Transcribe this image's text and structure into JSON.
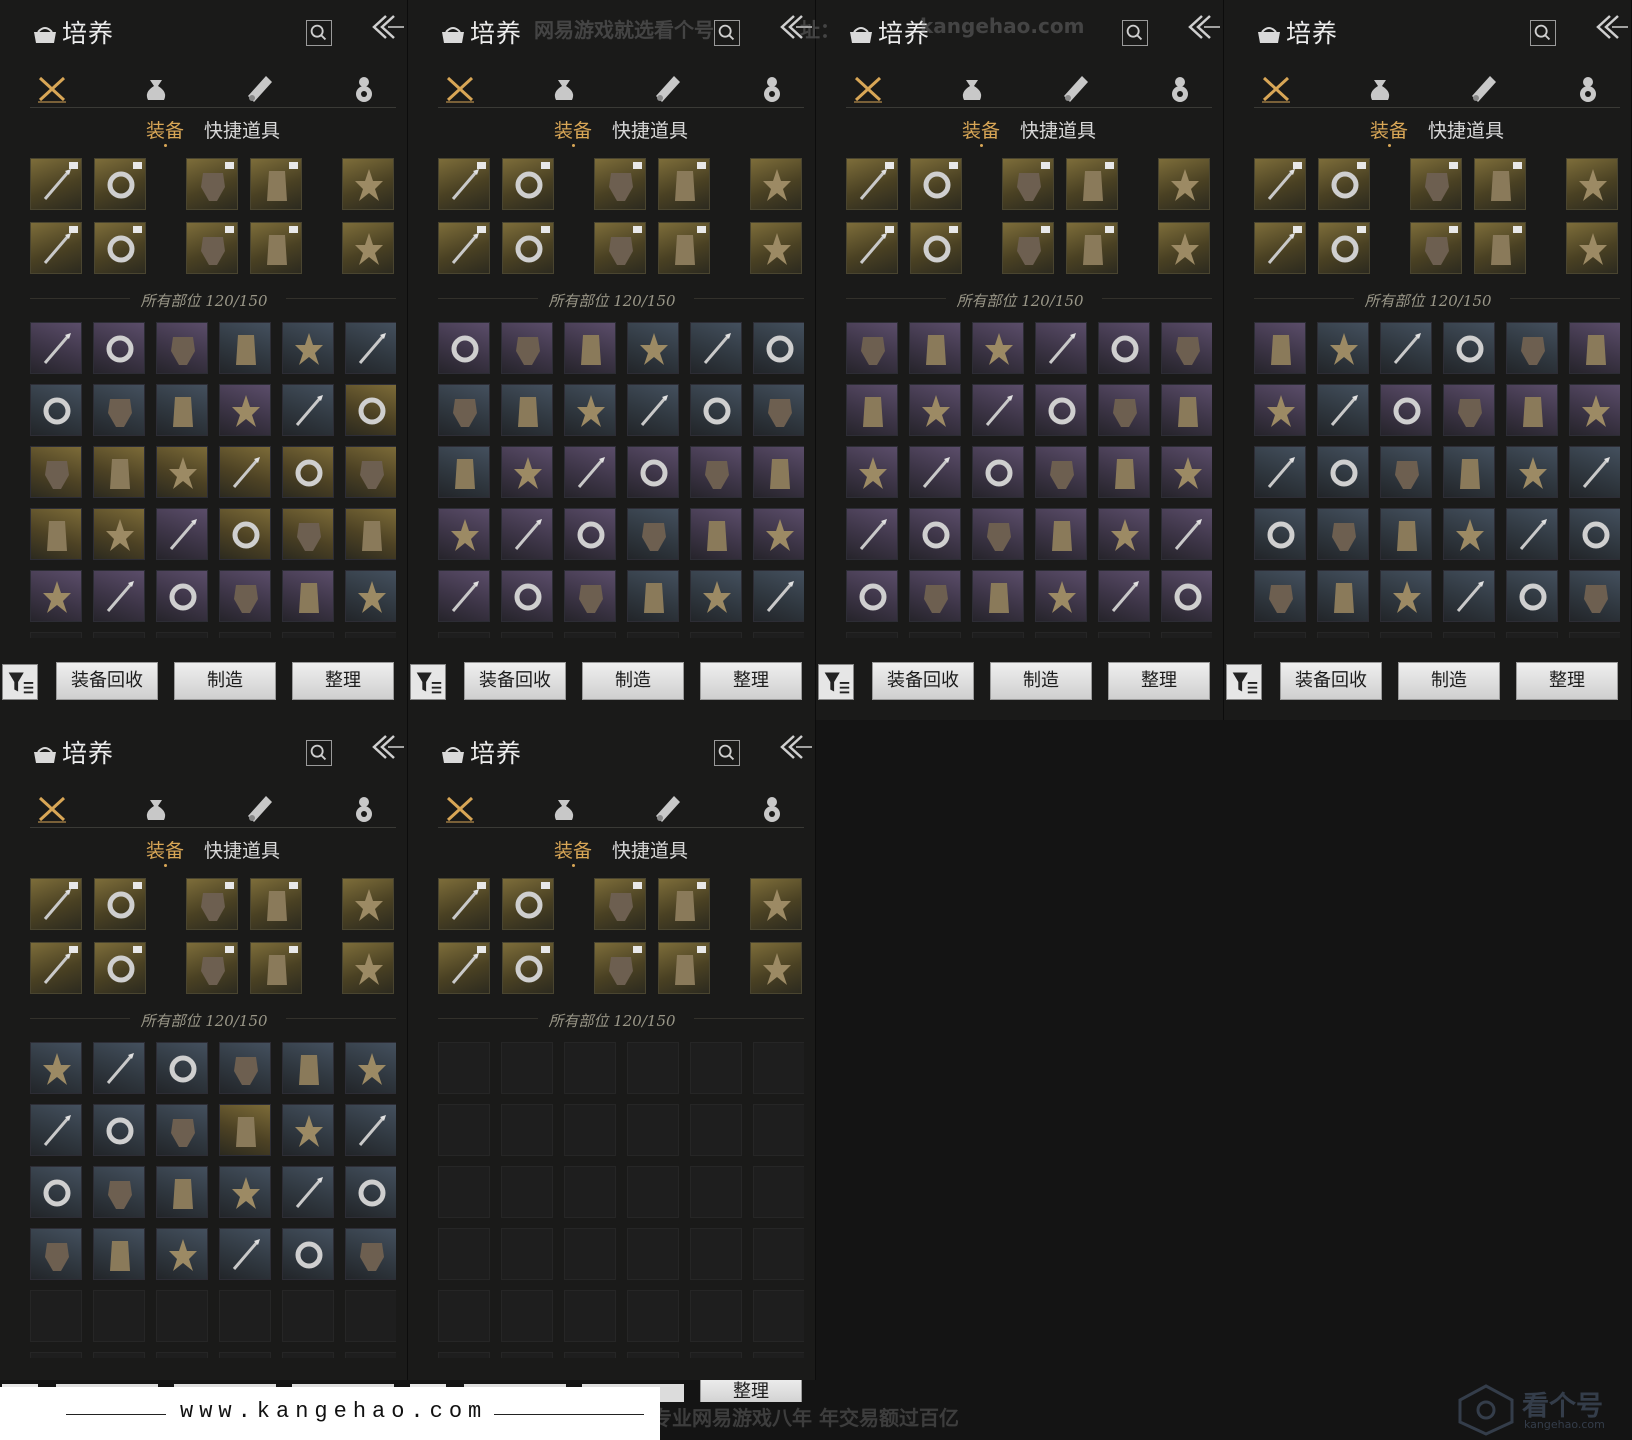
{
  "panel_title": "培养",
  "tabs": {
    "equip": "装备",
    "quick": "快捷道具"
  },
  "capacity_label": "所有部位 120/150",
  "buttons": {
    "recycle": "装备回收",
    "craft": "制造",
    "sort": "整理"
  },
  "category_icons": [
    "crossed-swords-icon",
    "pouch-icon",
    "scroll-icon",
    "gourd-icon"
  ],
  "watermarks": {
    "top": "网易游戏就选看个号",
    "top_url_label": "址：",
    "top_url": "kangehao.com",
    "bottom_slogan": "看个号专业网易游戏八年   年交易额过百亿",
    "footer_url": "www.kangehao.com",
    "brand_name": "看个号",
    "brand_sub": "kangehao.com"
  },
  "colors": {
    "accent_gold": "#d8a656",
    "rarity_gold": "#6b5d30",
    "rarity_purple": "#4e4360",
    "rarity_blue": "#3a4553"
  },
  "inventories": [
    {
      "rarities": [
        "p",
        "p",
        "p",
        "b",
        "b",
        "b",
        "b",
        "b",
        "b",
        "p",
        "b",
        "g",
        "g",
        "g",
        "g",
        "g",
        "g",
        "g",
        "g",
        "g",
        "p",
        "g",
        "g",
        "g",
        "p",
        "p",
        "p",
        "p",
        "p",
        "b"
      ]
    },
    {
      "rarities": [
        "p",
        "p",
        "p",
        "b",
        "b",
        "b",
        "b",
        "b",
        "b",
        "b",
        "b",
        "b",
        "b",
        "p",
        "p",
        "p",
        "p",
        "p",
        "p",
        "p",
        "p",
        "b",
        "p",
        "p",
        "p",
        "p",
        "p",
        "b",
        "b",
        "b"
      ]
    },
    {
      "rarities": [
        "p",
        "p",
        "p",
        "p",
        "p",
        "p",
        "p",
        "p",
        "p",
        "p",
        "p",
        "p",
        "p",
        "p",
        "p",
        "p",
        "p",
        "p",
        "p",
        "p",
        "p",
        "p",
        "p",
        "p",
        "p",
        "p",
        "p",
        "p",
        "p",
        "p"
      ]
    },
    {
      "rarities": [
        "p",
        "b",
        "b",
        "b",
        "b",
        "p",
        "p",
        "b",
        "p",
        "p",
        "p",
        "p",
        "b",
        "b",
        "b",
        "b",
        "b",
        "b",
        "b",
        "b",
        "b",
        "b",
        "b",
        "b",
        "b",
        "b",
        "b",
        "b",
        "b",
        "b"
      ]
    },
    {
      "rarities": [
        "b",
        "b",
        "b",
        "b",
        "b",
        "b",
        "b",
        "b",
        "b",
        "g",
        "b",
        "b",
        "b",
        "b",
        "b",
        "b",
        "b",
        "b",
        "b",
        "b",
        "b",
        "b",
        "b",
        "b",
        "e",
        "e",
        "e",
        "e",
        "e",
        "e"
      ]
    },
    {
      "rarities": [
        "e",
        "e",
        "e",
        "e",
        "e",
        "e",
        "e",
        "e",
        "e",
        "e",
        "e",
        "e",
        "e",
        "e",
        "e",
        "e",
        "e",
        "e",
        "e",
        "e",
        "e",
        "e",
        "e",
        "e",
        "e",
        "e",
        "e",
        "e",
        "e",
        "e"
      ]
    }
  ]
}
